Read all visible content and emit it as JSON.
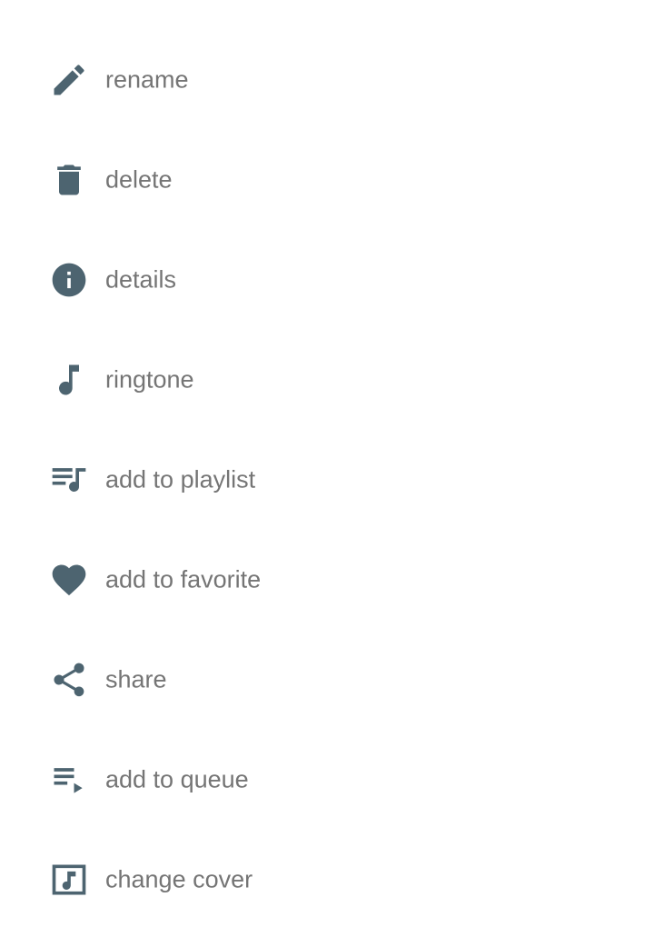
{
  "icon_color": "#4d6470",
  "text_color": "#757575",
  "menu": {
    "items": [
      {
        "label": "rename",
        "icon": "pencil-icon"
      },
      {
        "label": "delete",
        "icon": "trash-icon"
      },
      {
        "label": "details",
        "icon": "info-icon"
      },
      {
        "label": "ringtone",
        "icon": "music-note-icon"
      },
      {
        "label": "add to playlist",
        "icon": "playlist-add-icon"
      },
      {
        "label": "add to favorite",
        "icon": "heart-icon"
      },
      {
        "label": "share",
        "icon": "share-icon"
      },
      {
        "label": "add to queue",
        "icon": "queue-icon"
      },
      {
        "label": "change cover",
        "icon": "cover-music-icon"
      }
    ]
  }
}
